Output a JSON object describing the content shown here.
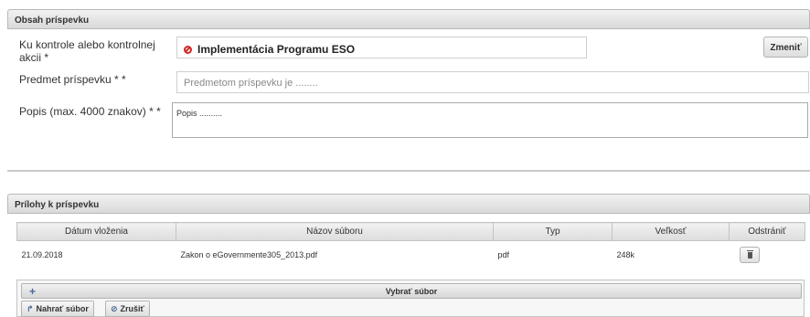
{
  "content_section": {
    "title": "Obsah príspevku",
    "control_label_line1": "Ku kontrole alebo kontrolnej",
    "control_label_line2": "akcii *",
    "control_value": "Implementácia Programu ESO",
    "change_button": "Zmeniť",
    "subject_label": "Predmet príspevku * *",
    "subject_placeholder": "Predmetom príspevku je ........",
    "description_label": "Popis (max. 4000 znakov) * *",
    "description_value": "Popis .........."
  },
  "attachments_section": {
    "title": "Prílohy k príspevku",
    "columns": [
      "Dátum vloženia",
      "Názov súboru",
      "Typ",
      "Veľkosť",
      "Odstrániť"
    ],
    "rows": [
      {
        "date": "21.09.2018",
        "name": "Zakon o eGovernmente305_2013.pdf",
        "type": "pdf",
        "size": "248k"
      }
    ],
    "select_file": "Vybrať súbor",
    "upload_button": "Nahrať súbor",
    "cancel_button": "Zrušiť"
  }
}
